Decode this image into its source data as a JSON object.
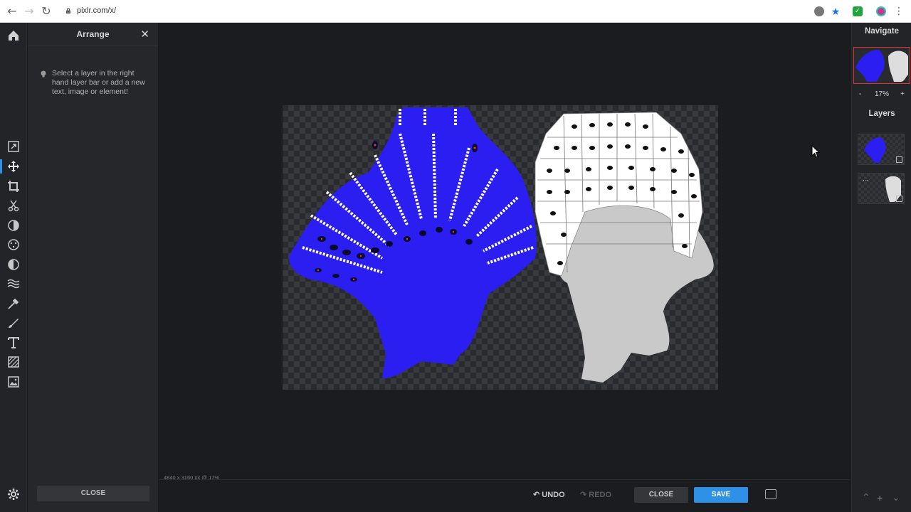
{
  "browser": {
    "url": "pixlr.com/x/",
    "icons": [
      "back-icon",
      "forward-icon",
      "reload-icon",
      "lock-icon",
      "extension-icon",
      "star-icon",
      "checkmark-extension-icon",
      "profile-icon",
      "menu-icon"
    ]
  },
  "tools": [
    {
      "name": "home-icon"
    },
    {
      "name": "open-image-icon"
    },
    {
      "name": "arrange-icon",
      "active": true
    },
    {
      "name": "crop-icon"
    },
    {
      "name": "cutout-icon"
    },
    {
      "name": "adjust-icon"
    },
    {
      "name": "filter-icon"
    },
    {
      "name": "liquify-icon"
    },
    {
      "name": "wave-icon"
    },
    {
      "name": "retouch-icon"
    },
    {
      "name": "draw-icon"
    },
    {
      "name": "text-icon"
    },
    {
      "name": "pattern-icon"
    },
    {
      "name": "image-icon"
    },
    {
      "name": "settings-icon"
    }
  ],
  "panel": {
    "title": "Arrange",
    "hint": "Select a layer in the right hand layer bar or add a new text, image or element!",
    "close_label": "CLOSE"
  },
  "status": "4840 x 3160 px @ 17%",
  "bottom": {
    "undo_label": "UNDO",
    "redo_label": "REDO",
    "close_label": "CLOSE",
    "save_label": "SAVE"
  },
  "right_panel": {
    "navigate_title": "Navigate",
    "zoom": "17%",
    "zoom_minus": "-",
    "zoom_plus": "+",
    "layers_title": "Layers",
    "layer_more": "...",
    "bottom_icons": [
      "collapse-icon",
      "add-layer-icon",
      "expand-icon"
    ]
  },
  "colors": {
    "accent": "#2e90e6",
    "blue_figure": "#2a1ff0",
    "gray_figure": "#cccccc",
    "nav_border": "#dd3333"
  }
}
